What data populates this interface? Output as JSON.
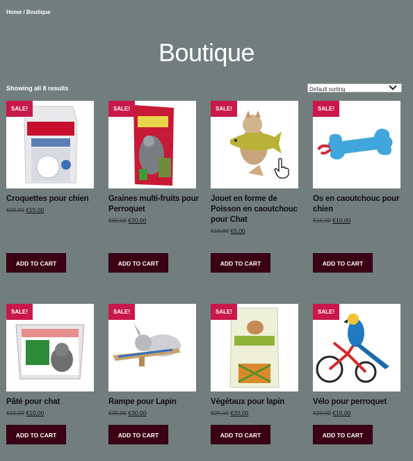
{
  "breadcrumb": {
    "home": "Home",
    "sep": " / ",
    "current": "Boutique"
  },
  "page_title": "Boutique",
  "results_count": "Showing all 8 results",
  "sorting": {
    "selected": "Default sorting"
  },
  "sale_label": "SALE!",
  "add_to_cart_label": "ADD TO CART",
  "products": [
    {
      "name": "Croquettes pour chien",
      "old_price": "€20,00",
      "new_price": "€15,00",
      "icon": "dog-food-bag-icon"
    },
    {
      "name": "Graines multi-fruits pour Perroquet",
      "old_price": "€30,00",
      "new_price": "€20,00",
      "icon": "parrot-food-bag-icon"
    },
    {
      "name": "Jouet en forme de Poisson en caoutchouc pour Chat",
      "old_price": "€10,00",
      "new_price": "€5,00",
      "icon": "fish-toy-icon"
    },
    {
      "name": "Os en caoutchouc pour chien",
      "old_price": "€15,00",
      "new_price": "€10,00",
      "icon": "rubber-bone-icon"
    },
    {
      "name": "Pâté pour chat",
      "old_price": "€15,00",
      "new_price": "€10,00",
      "icon": "cat-pate-tray-icon"
    },
    {
      "name": "Rampe pour Lapin",
      "old_price": "€35,00",
      "new_price": "€30,00",
      "icon": "rabbit-ramp-icon"
    },
    {
      "name": "Végétaux pour lapin",
      "old_price": "€25,00",
      "new_price": "€20,00",
      "icon": "rabbit-food-bag-icon"
    },
    {
      "name": "Vélo pour perroquet",
      "old_price": "€20,00",
      "new_price": "€15,00",
      "icon": "parrot-bike-icon"
    }
  ],
  "colors": {
    "background": "#717e7d",
    "sale_badge": "#c9184a",
    "button": "#3b0014"
  }
}
